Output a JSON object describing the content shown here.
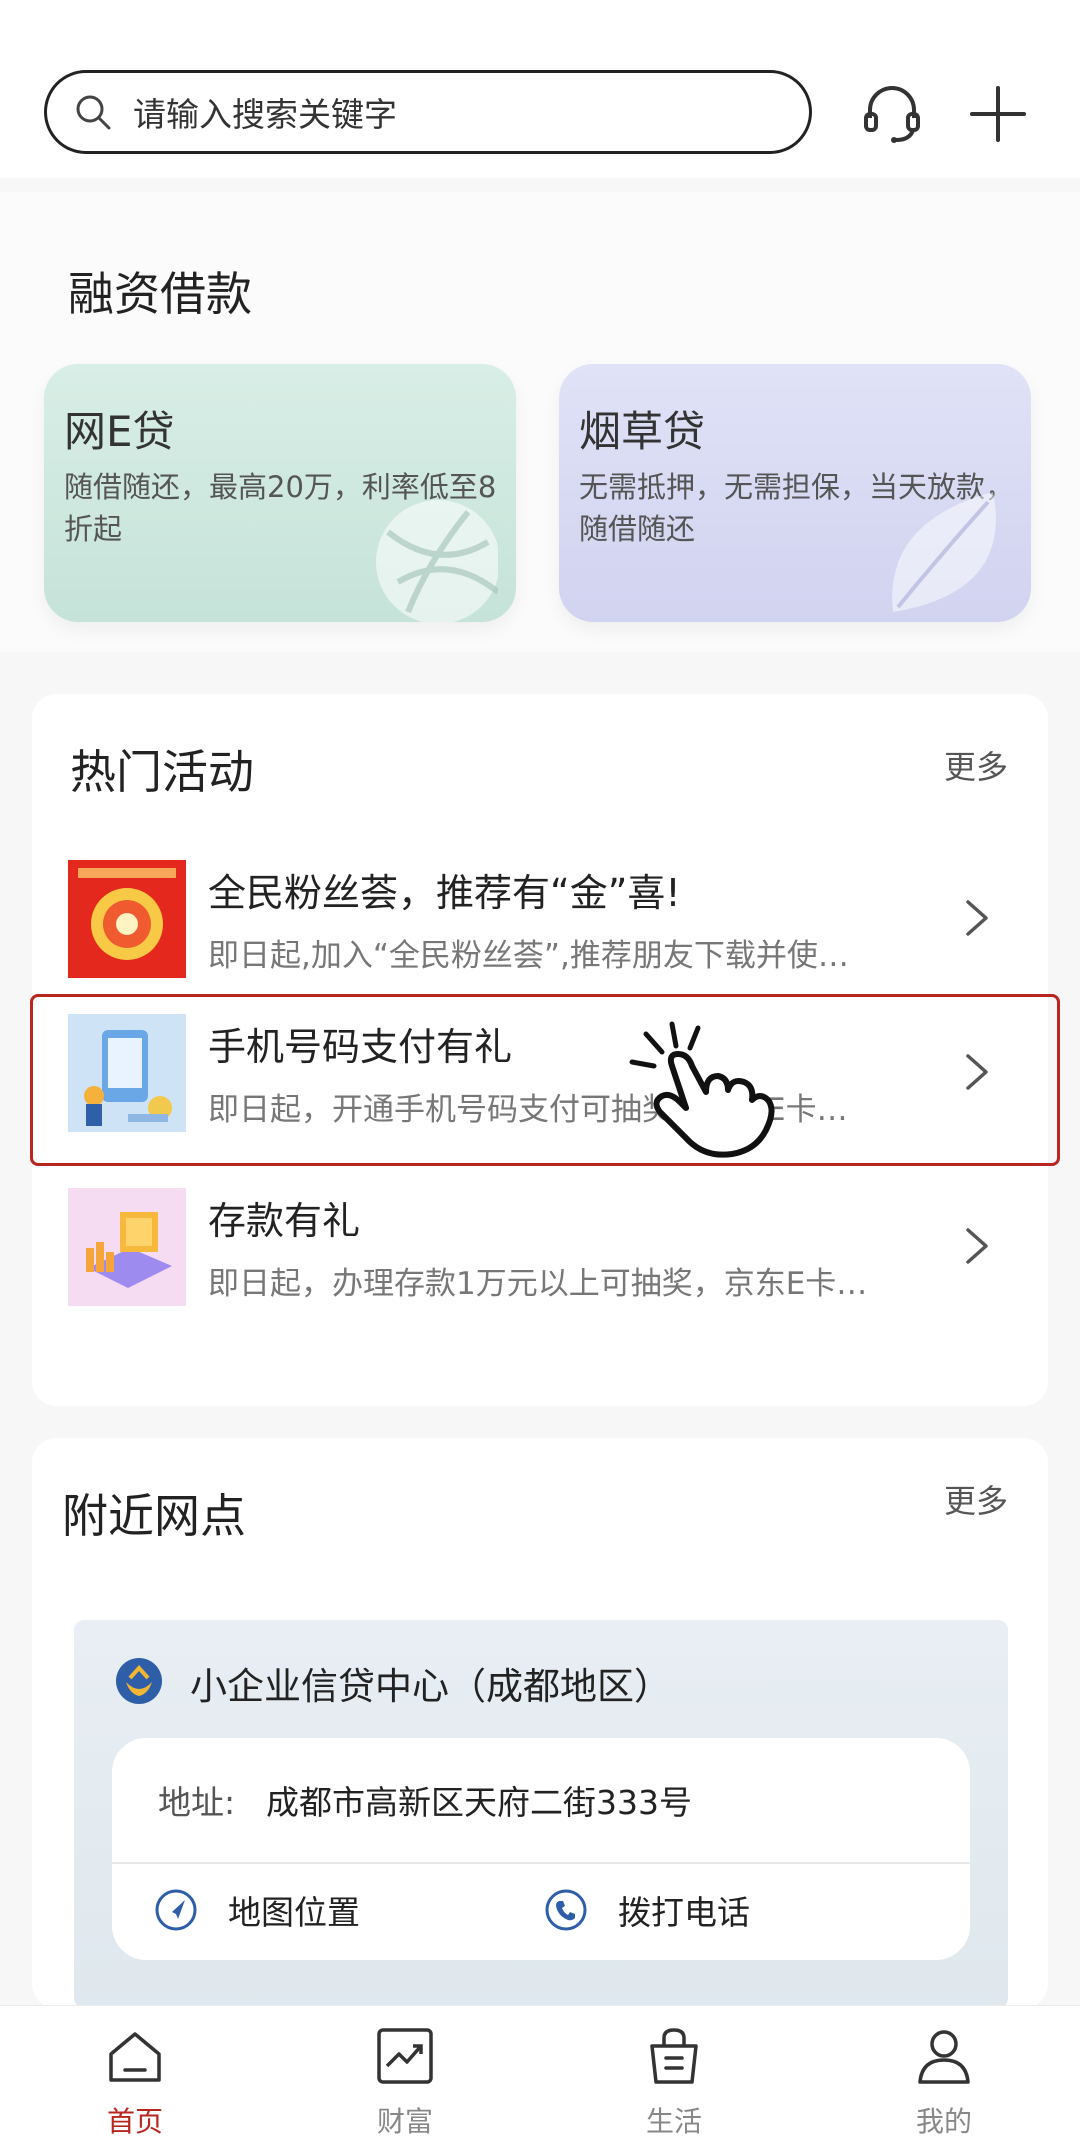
{
  "header": {
    "search_placeholder": "请输入搜索关键字",
    "icons": [
      "search-icon",
      "headset-icon",
      "plus-icon"
    ]
  },
  "financing": {
    "title": "融资借款",
    "cards": [
      {
        "name": "网E贷",
        "desc": "随借随还，最高20万，利率低至8折起"
      },
      {
        "name": "烟草贷",
        "desc": "无需抵押，无需担保，当天放款，随借随还"
      }
    ]
  },
  "hot_activities": {
    "title": "热门活动",
    "more": "更多",
    "items": [
      {
        "title": "全民粉丝荟，推荐有“金”喜!",
        "sub": "即日起,加入“全民粉丝荟”,推荐朋友下载并使…"
      },
      {
        "title": "手机号码支付有礼",
        "sub": "即日起，开通手机号码支付可抽奖，京东E卡…"
      },
      {
        "title": "存款有礼",
        "sub": "即日起，办理存款1万元以上可抽奖，京东E卡…"
      }
    ]
  },
  "nearby": {
    "title": "附近网点",
    "more": "更多",
    "branch": {
      "name": "小企业信贷中心（成都地区）",
      "address_label": "地址:",
      "address": "成都市高新区天府二街333号",
      "map_label": "地图位置",
      "call_label": "拨打电话"
    }
  },
  "bottom_nav": {
    "items": [
      {
        "label": "首页",
        "active": true
      },
      {
        "label": "财富",
        "active": false
      },
      {
        "label": "生活",
        "active": false
      },
      {
        "label": "我的",
        "active": false
      }
    ]
  },
  "colors": {
    "accent": "#b8261f",
    "loan_green": "#c6e3d9",
    "loan_purple": "#d1d3f0"
  }
}
